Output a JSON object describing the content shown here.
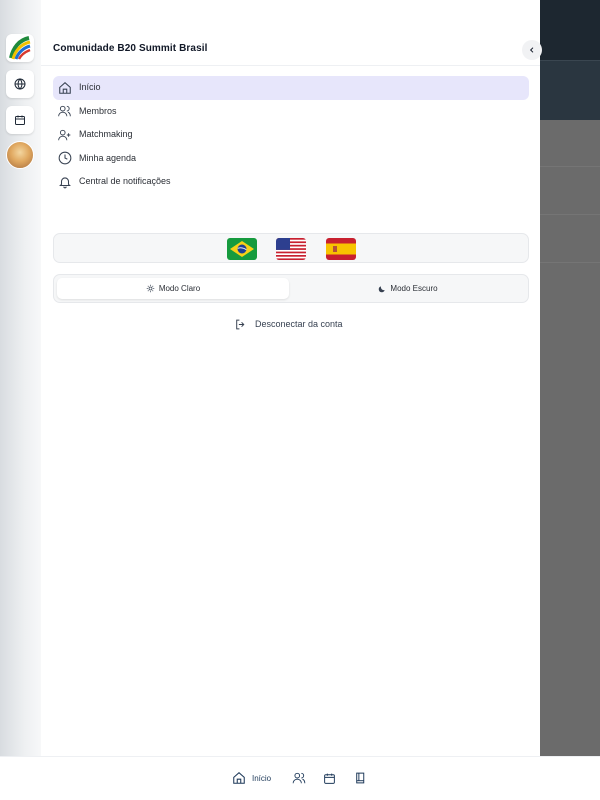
{
  "community": {
    "title": "Comunidade B20 Summit Brasil"
  },
  "nav": {
    "items": [
      {
        "label": "Início",
        "icon": "home-icon",
        "active": true
      },
      {
        "label": "Membros",
        "icon": "users-icon",
        "active": false
      },
      {
        "label": "Matchmaking",
        "icon": "user-plus-icon",
        "active": false
      },
      {
        "label": "Minha agenda",
        "icon": "clock-icon",
        "active": false
      },
      {
        "label": "Central de notificações",
        "icon": "bell-icon",
        "active": false
      }
    ]
  },
  "languages": [
    "pt-BR",
    "en-US",
    "es-ES"
  ],
  "theme": {
    "light_label": "Modo Claro",
    "dark_label": "Modo Escuro",
    "selected": "light"
  },
  "account": {
    "logout_label": "Desconectar da conta"
  },
  "bottom_nav": {
    "home_label": "Início",
    "icons": [
      "home-icon",
      "users-icon",
      "calendar-icon",
      "book-icon"
    ]
  },
  "colors": {
    "accent_bg": "#e7e6fb",
    "overlay": "#6b6b6b",
    "text_primary": "#111827",
    "bottom_nav_text": "#1f3a5a"
  }
}
